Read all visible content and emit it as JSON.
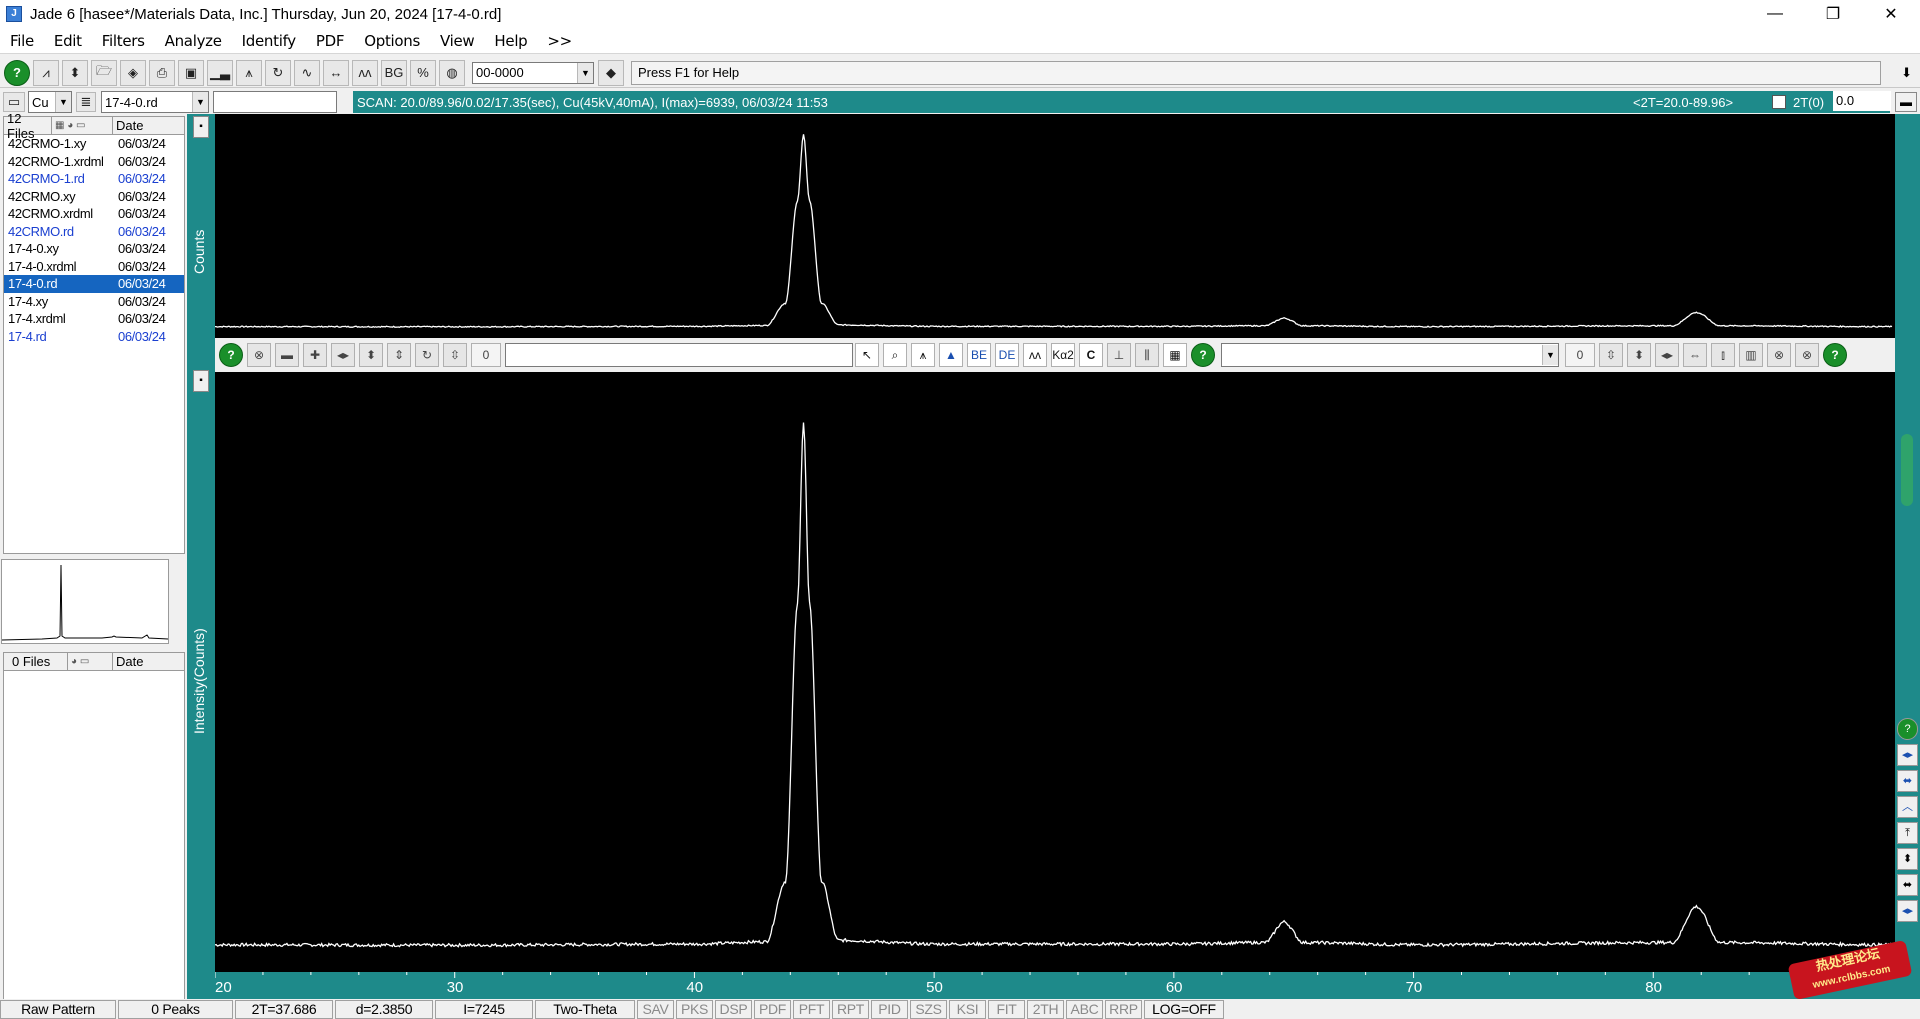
{
  "window": {
    "title": "Jade 6 [hasee*/Materials Data, Inc.] Thursday, Jun 20, 2024 [17-4-0.rd]",
    "minimize": "—",
    "restore": "❐",
    "close": "✕"
  },
  "menu": [
    "File",
    "Edit",
    "Filters",
    "Analyze",
    "Identify",
    "PDF",
    "Options",
    "View",
    "Help",
    ">>"
  ],
  "toolbar": {
    "pdf_combo": "00-0000",
    "help_text": "Press F1 for Help",
    "pin": "⬇"
  },
  "toolbar2": {
    "anode": "Cu",
    "file_combo": "17-4-0.rd"
  },
  "scan": {
    "info": "SCAN: 20.0/89.96/0.02/17.35(sec), Cu(45kV,40mA), I(max)=6939, 06/03/24 11:53",
    "range": "<2T=20.0-89.96>",
    "offset_label": "2T(0)",
    "offset_value": "0.0"
  },
  "file_list": {
    "count_label": "12 Files",
    "date_header": "Date",
    "files": [
      {
        "name": "42CRMO-1.xy",
        "date": "06/03/24",
        "blue": false,
        "selected": false
      },
      {
        "name": "42CRMO-1.xrdml",
        "date": "06/03/24",
        "blue": false,
        "selected": false
      },
      {
        "name": "42CRMO-1.rd",
        "date": "06/03/24",
        "blue": true,
        "selected": false
      },
      {
        "name": "42CRMO.xy",
        "date": "06/03/24",
        "blue": false,
        "selected": false
      },
      {
        "name": "42CRMO.xrdml",
        "date": "06/03/24",
        "blue": false,
        "selected": false
      },
      {
        "name": "42CRMO.rd",
        "date": "06/03/24",
        "blue": true,
        "selected": false
      },
      {
        "name": "17-4-0.xy",
        "date": "06/03/24",
        "blue": false,
        "selected": false
      },
      {
        "name": "17-4-0.xrdml",
        "date": "06/03/24",
        "blue": false,
        "selected": false
      },
      {
        "name": "17-4-0.rd",
        "date": "06/03/24",
        "blue": false,
        "selected": true
      },
      {
        "name": "17-4.xy",
        "date": "06/03/24",
        "blue": false,
        "selected": false
      },
      {
        "name": "17-4.xrdml",
        "date": "06/03/24",
        "blue": false,
        "selected": false
      },
      {
        "name": "17-4.rd",
        "date": "06/03/24",
        "blue": true,
        "selected": false
      }
    ]
  },
  "file_list2": {
    "count_label": "0 Files",
    "date_header": "Date"
  },
  "plots": {
    "top_ylabel": "Counts",
    "main_ylabel": "Intensity(Counts)",
    "midbar_zero_left": "0",
    "midbar_zero_right": "0"
  },
  "chart_data": {
    "type": "line",
    "title": "",
    "xlabel": "",
    "ylabel": "Intensity(Counts)",
    "xlim": [
      20,
      90
    ],
    "ylim": [
      0,
      7245
    ],
    "x_ticks": [
      20,
      30,
      40,
      50,
      60,
      70,
      80
    ],
    "background": "#000000",
    "line_color": "#ffffff",
    "series": [
      {
        "x": [
          20,
          30,
          40,
          43,
          43.8,
          44.3,
          44.55,
          44.8,
          45.3,
          46,
          50,
          60,
          63.8,
          64.6,
          65.4,
          70,
          80.8,
          81.8,
          82.8,
          89.96
        ],
        "y": [
          120,
          115,
          130,
          160,
          950,
          4600,
          6939,
          4600,
          950,
          180,
          130,
          130,
          150,
          420,
          150,
          120,
          150,
          620,
          150,
          120
        ]
      }
    ]
  },
  "status": {
    "raw_pattern": "Raw Pattern",
    "peaks": "0 Peaks",
    "two_theta": "2T=37.686",
    "d_spacing": "d=2.3850",
    "intensity": "I=7245",
    "axis_mode": "Two-Theta",
    "flags": [
      "SAV",
      "PKS",
      "DSP",
      "PDF",
      "PFT",
      "RPT",
      "PID",
      "SZS",
      "KSI",
      "FIT",
      "2TH",
      "ABC",
      "RRP"
    ],
    "log": "LOG=OFF"
  }
}
